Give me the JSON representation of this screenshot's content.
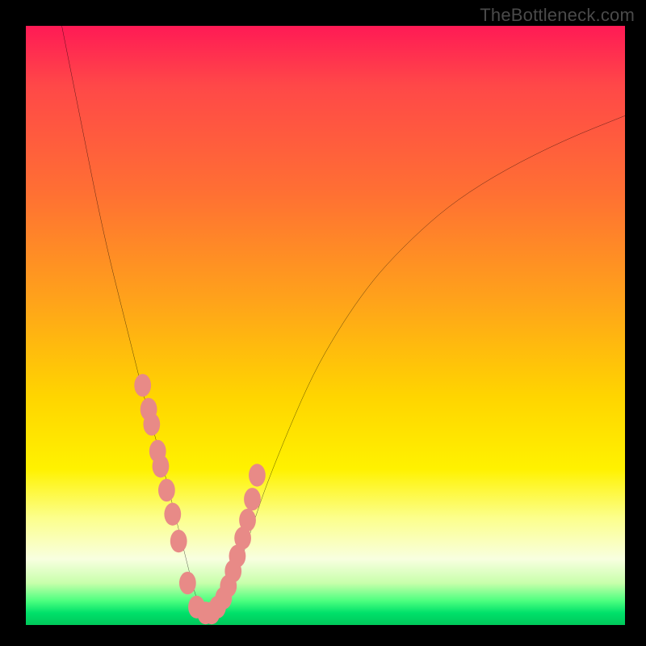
{
  "watermark": "TheBottleneck.com",
  "chart_data": {
    "type": "line",
    "title": "",
    "xlabel": "",
    "ylabel": "",
    "xlim": [
      0,
      100
    ],
    "ylim": [
      0,
      100
    ],
    "grid": false,
    "series": [
      {
        "name": "bottleneck-curve",
        "x": [
          6,
          8,
          10,
          12,
          14,
          16,
          18,
          20,
          22,
          24,
          25,
          26,
          27,
          28,
          29,
          30,
          31,
          32,
          34,
          36,
          38,
          40,
          44,
          48,
          52,
          56,
          60,
          66,
          72,
          80,
          90,
          100
        ],
        "y": [
          100,
          90,
          80,
          70,
          61,
          53,
          45,
          37,
          30,
          22,
          18,
          14,
          10,
          6,
          3,
          2,
          2,
          3,
          6,
          11,
          17,
          23,
          33,
          42,
          49,
          55,
          60,
          66,
          71,
          76,
          81,
          85
        ]
      }
    ],
    "markers": {
      "name": "highlight-dots",
      "x": [
        19.5,
        20.5,
        21.0,
        22.0,
        22.5,
        23.5,
        24.5,
        25.5,
        27.0,
        28.5,
        30.0,
        31.0,
        32.0,
        33.0,
        33.8,
        34.6,
        35.3,
        36.2,
        37.0,
        37.8,
        38.6
      ],
      "y": [
        40.0,
        36.0,
        33.5,
        29.0,
        26.5,
        22.5,
        18.5,
        14.0,
        7.0,
        3.0,
        2.0,
        2.0,
        3.0,
        4.5,
        6.5,
        9.0,
        11.5,
        14.5,
        17.5,
        21.0,
        25.0
      ]
    },
    "background_gradient": {
      "direction": "vertical",
      "stops": [
        {
          "pos": 0,
          "color": "#ff1a55"
        },
        {
          "pos": 28,
          "color": "#ff7033"
        },
        {
          "pos": 62,
          "color": "#ffd500"
        },
        {
          "pos": 89,
          "color": "#f8ffe0"
        },
        {
          "pos": 100,
          "color": "#00c85a"
        }
      ]
    }
  }
}
